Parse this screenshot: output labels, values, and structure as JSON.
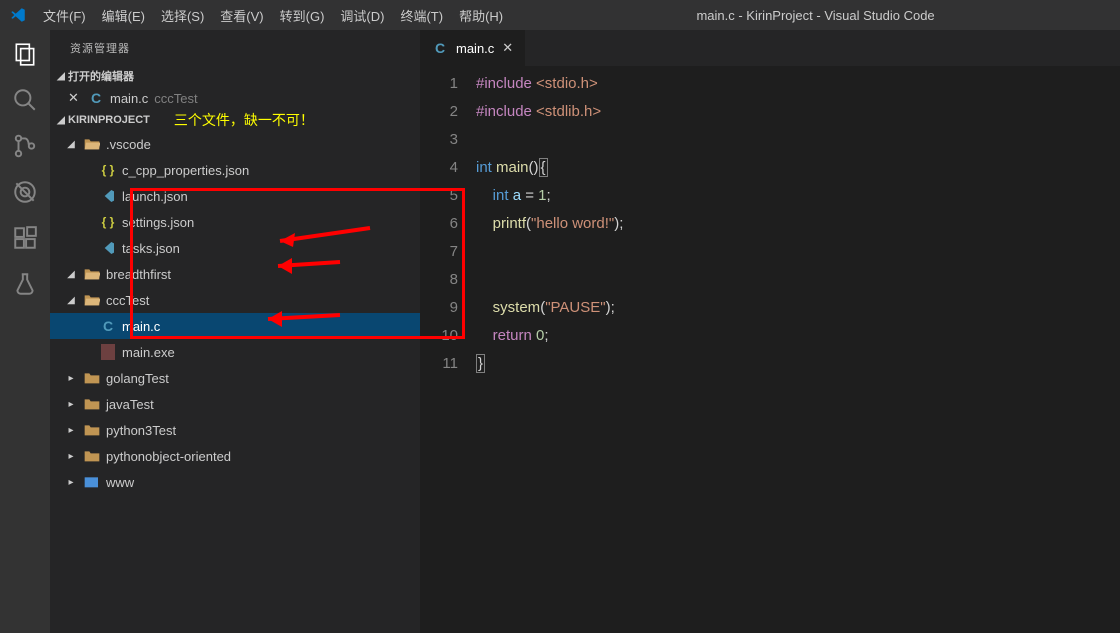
{
  "titlebar": {
    "menus": [
      "文件(F)",
      "编辑(E)",
      "选择(S)",
      "查看(V)",
      "转到(G)",
      "调试(D)",
      "终端(T)",
      "帮助(H)"
    ],
    "title": "main.c - KirinProject - Visual Studio Code"
  },
  "sidebar": {
    "header": "资源管理器",
    "open_editors_label": "打开的编辑器",
    "open_editors": [
      {
        "icon": "C",
        "name": "main.c",
        "path": "cccTest"
      }
    ],
    "project_name": "KIRINPROJECT",
    "annotation": "三个文件，缺一不可！",
    "tree": [
      {
        "name": ".vscode",
        "type": "folder-open",
        "indent": 1,
        "expanded": true
      },
      {
        "name": "c_cpp_properties.json",
        "type": "json",
        "indent": 2
      },
      {
        "name": "launch.json",
        "type": "vscode-json",
        "indent": 2
      },
      {
        "name": "settings.json",
        "type": "json",
        "indent": 2
      },
      {
        "name": "tasks.json",
        "type": "vscode-json",
        "indent": 2
      },
      {
        "name": "breadthfirst",
        "type": "folder-open",
        "indent": 1,
        "expanded": true
      },
      {
        "name": "cccTest",
        "type": "folder-open",
        "indent": 1,
        "expanded": true
      },
      {
        "name": "main.c",
        "type": "c",
        "indent": 2,
        "selected": true
      },
      {
        "name": "main.exe",
        "type": "exe",
        "indent": 2
      },
      {
        "name": "golangTest",
        "type": "folder",
        "indent": 1,
        "expanded": false
      },
      {
        "name": "javaTest",
        "type": "folder",
        "indent": 1,
        "expanded": false
      },
      {
        "name": "python3Test",
        "type": "folder",
        "indent": 1,
        "expanded": false
      },
      {
        "name": "pythonobject-oriented",
        "type": "folder",
        "indent": 1,
        "expanded": false
      },
      {
        "name": "www",
        "type": "folder-special",
        "indent": 1,
        "expanded": false
      }
    ]
  },
  "editor": {
    "tab": {
      "icon": "C",
      "name": "main.c"
    },
    "lines": [
      [
        {
          "c": "tok-pp",
          "t": "#include "
        },
        {
          "c": "tok-str",
          "t": "<stdio.h>"
        }
      ],
      [
        {
          "c": "tok-pp",
          "t": "#include "
        },
        {
          "c": "tok-str",
          "t": "<stdlib.h>"
        }
      ],
      [],
      [
        {
          "c": "tok-kw",
          "t": "int"
        },
        {
          "c": "tok-default",
          "t": " "
        },
        {
          "c": "tok-fn",
          "t": "main"
        },
        {
          "c": "tok-default",
          "t": "()"
        },
        {
          "c": "tok-default cursor-box",
          "t": "{"
        }
      ],
      [
        {
          "c": "tok-default",
          "t": "    "
        },
        {
          "c": "tok-kw",
          "t": "int"
        },
        {
          "c": "tok-default",
          "t": " "
        },
        {
          "c": "tok-var",
          "t": "a"
        },
        {
          "c": "tok-default",
          "t": " = "
        },
        {
          "c": "tok-num",
          "t": "1"
        },
        {
          "c": "tok-default",
          "t": ";"
        }
      ],
      [
        {
          "c": "tok-default",
          "t": "    "
        },
        {
          "c": "tok-fn",
          "t": "printf"
        },
        {
          "c": "tok-default",
          "t": "("
        },
        {
          "c": "tok-str",
          "t": "\"hello word!\""
        },
        {
          "c": "tok-default",
          "t": ");"
        }
      ],
      [],
      [],
      [
        {
          "c": "tok-default",
          "t": "    "
        },
        {
          "c": "tok-fn",
          "t": "system"
        },
        {
          "c": "tok-default",
          "t": "("
        },
        {
          "c": "tok-str",
          "t": "\"PAUSE\""
        },
        {
          "c": "tok-default",
          "t": ");"
        }
      ],
      [
        {
          "c": "tok-default",
          "t": "    "
        },
        {
          "c": "tok-pp",
          "t": "return"
        },
        {
          "c": "tok-default",
          "t": " "
        },
        {
          "c": "tok-num",
          "t": "0"
        },
        {
          "c": "tok-default",
          "t": ";"
        }
      ],
      [
        {
          "c": "tok-default cursor-box",
          "t": "}"
        }
      ]
    ]
  }
}
